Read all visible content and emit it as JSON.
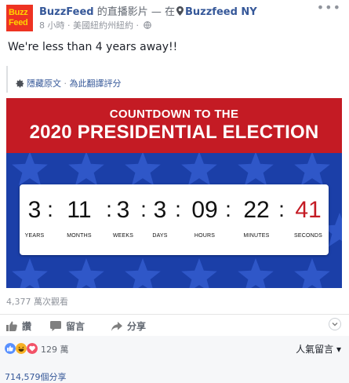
{
  "post": {
    "logo_line1": "Buzz",
    "logo_line2": "Feed",
    "page_name": "BuzzFeed",
    "live_text": " 的直播影片 — 在",
    "location": "Buzzfeed NY",
    "more": "•••",
    "time": "8 小時",
    "meta_sep": " · ",
    "place": "美國紐約州紐約",
    "meta_sep2": " · ",
    "text": "We're less than 4 years away!!",
    "hide_original": "隱藏原文",
    "translate_sep": " · ",
    "rate_translation": "為此翻譯評分"
  },
  "video": {
    "subtitle": "COUNTDOWN TO THE",
    "title": "2020 PRESIDENTIAL ELECTION",
    "colors": {
      "banner": "#c41b24",
      "field": "#1b3fa8",
      "star": "#2f57c8",
      "seconds": "#c41b24"
    },
    "units": [
      {
        "value": "3",
        "label": "YEARS"
      },
      {
        "value": "11",
        "label": "MONTHS"
      },
      {
        "value": "3",
        "label": "WEEKS"
      },
      {
        "value": "3",
        "label": "DAYS"
      },
      {
        "value": "09",
        "label": "HOURS"
      },
      {
        "value": "22",
        "label": "MINUTES"
      },
      {
        "value": "41",
        "label": "SECONDS"
      }
    ],
    "colon": ":"
  },
  "stats": {
    "views": "4,377 萬次觀看"
  },
  "actions": {
    "like": "讚",
    "comment": "留言",
    "share": "分享"
  },
  "reactions": {
    "icons": [
      "like-icon",
      "haha-icon",
      "love-icon"
    ],
    "count": "129 萬",
    "sort_label": "人氣留言",
    "sort_caret": "▾"
  },
  "shares": {
    "count": "714,579個分享"
  }
}
